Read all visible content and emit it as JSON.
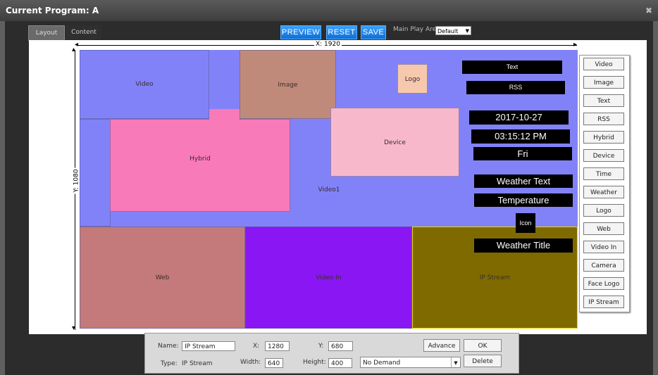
{
  "window": {
    "title": "Current Program: A",
    "close_glyph": "✖"
  },
  "tabs": [
    {
      "label": "Layout",
      "active": true
    },
    {
      "label": "Content",
      "active": false
    }
  ],
  "toolbar": {
    "preview": "PREVIEW",
    "reset": "RESET",
    "save": "SAVE",
    "main_play_area_label": "Main Play Area",
    "main_play_area_value": "Default"
  },
  "axes": {
    "x_label": "X: 1920",
    "y_label": "Y: 1080"
  },
  "regions": {
    "video": "Video",
    "image": "Image",
    "logo": "Logo",
    "hybrid": "Hybrid",
    "device": "Device",
    "video1": "Video1",
    "web": "Web",
    "video_in": "Video In",
    "ip_stream": "IP Stream"
  },
  "blocks": {
    "text": "Text",
    "rss": "RSS",
    "date": "2017-10-27",
    "time": "03:15:12 PM",
    "day": "Fri",
    "weather_text": "Weather Text",
    "temperature": "Temperature",
    "icon": "Icon",
    "weather_title": "Weather Title"
  },
  "sidebar": [
    "Video",
    "Image",
    "Text",
    "RSS",
    "Hybrid",
    "Device",
    "Time",
    "Weather",
    "Logo",
    "Web",
    "Video In",
    "Camera",
    "Face Logo",
    "IP Stream"
  ],
  "properties": {
    "name_label": "Name:",
    "name_value": "IP Stream",
    "x_label": "X:",
    "x_value": "1280",
    "y_label": "Y:",
    "y_value": "680",
    "type_label": "Type:",
    "type_value": "IP Stream",
    "width_label": "Width:",
    "width_value": "640",
    "height_label": "Height:",
    "height_value": "400",
    "demand_value": "No Demand",
    "advance": "Advance",
    "ok": "OK",
    "delete": "Delete"
  },
  "colors": {
    "stage": "#8282f8",
    "image": "#c08a7a",
    "logo": "#f6c9ae",
    "hybrid": "#f87ab8",
    "device": "#f8b8cc",
    "web": "#c47a7a",
    "video_in": "#8a16f4",
    "ip_stream": "#7f6a00",
    "accent_button": "#1e88f0"
  }
}
